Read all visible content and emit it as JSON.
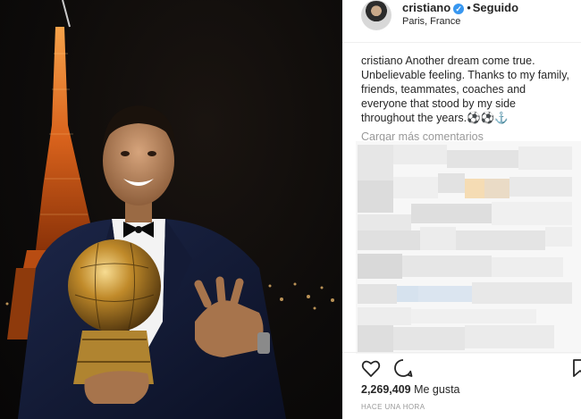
{
  "post": {
    "username": "cristiano",
    "separator": "•",
    "follow_label": "Seguido",
    "location": "Paris, France",
    "caption_user": "cristiano",
    "caption_text": "Another dream come true. Unbelievable feeling. Thanks to my family, friends, teammates, coaches and everyone that stood by my side throughout the years.",
    "caption_emojis": "⚽⚽⚓",
    "load_more": "Cargar más comentarios",
    "likes_count": "2,269,409",
    "likes_label": "Me gusta",
    "time_ago": "Hace una hora"
  },
  "icons": {
    "verified": "verified-badge-icon",
    "like": "heart-icon",
    "comment": "comment-icon",
    "save": "bookmark-icon"
  },
  "colors": {
    "verified": "#3897f0",
    "muted": "#999999",
    "text": "#262626"
  }
}
